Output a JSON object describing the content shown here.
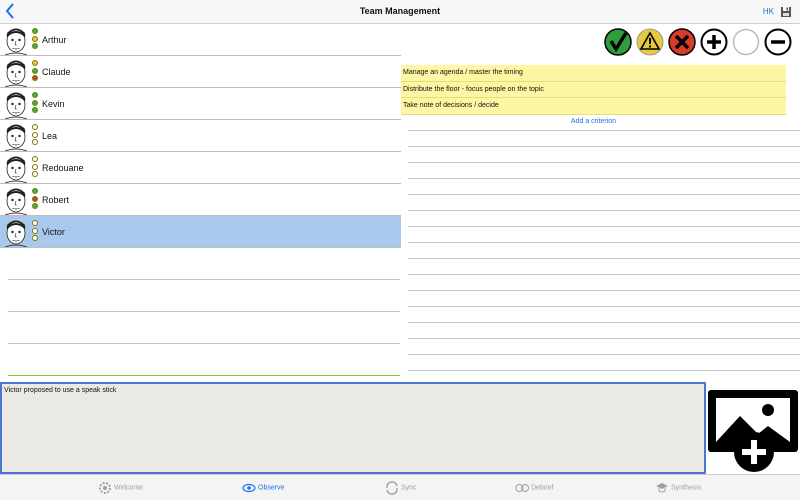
{
  "header": {
    "title": "Team Management",
    "back_icon": "chevron-left-icon",
    "hk_label": "HK",
    "save_icon": "floppy-disk-icon"
  },
  "people": [
    {
      "name": "Arthur",
      "avatar_icon": "face-sketch-icon",
      "lights": [
        "#3cb34a",
        "#e8c840",
        "#3cb34a"
      ]
    },
    {
      "name": "Claude",
      "avatar_icon": "face-sketch-icon",
      "lights": [
        "#e8c840",
        "#3cb34a",
        "#d83a2b"
      ]
    },
    {
      "name": "Kevin",
      "avatar_icon": "face-sketch-icon",
      "lights": [
        "#3cb34a",
        "#3cb34a",
        "#3cb34a"
      ]
    },
    {
      "name": "Lea",
      "avatar_icon": "face-sketch-icon",
      "lights": [
        "#ffffff",
        "#ffffff",
        "#ffffff"
      ]
    },
    {
      "name": "Redouane",
      "avatar_icon": "face-sketch-icon",
      "lights": [
        "#ffffff",
        "#ffffff",
        "#ffffff"
      ]
    },
    {
      "name": "Robert",
      "avatar_icon": "face-sketch-icon",
      "lights": [
        "#3cb34a",
        "#d83a2b",
        "#3cb34a"
      ]
    },
    {
      "name": "Victor",
      "avatar_icon": "face-sketch-icon",
      "lights": [
        "#ffffff",
        "#ffffff",
        "#ffffff"
      ]
    }
  ],
  "selected_person": "Victor",
  "actions": [
    {
      "name": "check-icon",
      "color": "#2e9e3e"
    },
    {
      "name": "warning-icon",
      "color": "#e8c840"
    },
    {
      "name": "cross-icon",
      "color": "#d83a2b"
    },
    {
      "name": "plus-icon",
      "color": "#000000"
    },
    {
      "name": "empty-circle-icon",
      "color": "#ffffff"
    },
    {
      "name": "minus-icon",
      "color": "#000000"
    }
  ],
  "criteria": [
    "Manage an agenda / master the timing",
    "Distribute the floor - focus people on the topic",
    "Take note of decisions / decide"
  ],
  "add_criterion_label": "Add a criterion",
  "notes": {
    "value": "Victor proposed to use a speak stick"
  },
  "add_image_icon": "add-image-icon",
  "tabs": [
    {
      "label": "Welcome",
      "icon": "gear-icon"
    },
    {
      "label": "Observe",
      "icon": "eye-icon",
      "active": true
    },
    {
      "label": "Sync",
      "icon": "sync-icon"
    },
    {
      "label": "Debrief",
      "icon": "faces-icon"
    },
    {
      "label": "Synthesis",
      "icon": "graduation-icon"
    }
  ],
  "colors": {
    "accent": "#1a73e8",
    "selected_row": "#a9c9ec",
    "criterion_bg": "#fdf6a3",
    "notes_border": "#4a78d0"
  }
}
